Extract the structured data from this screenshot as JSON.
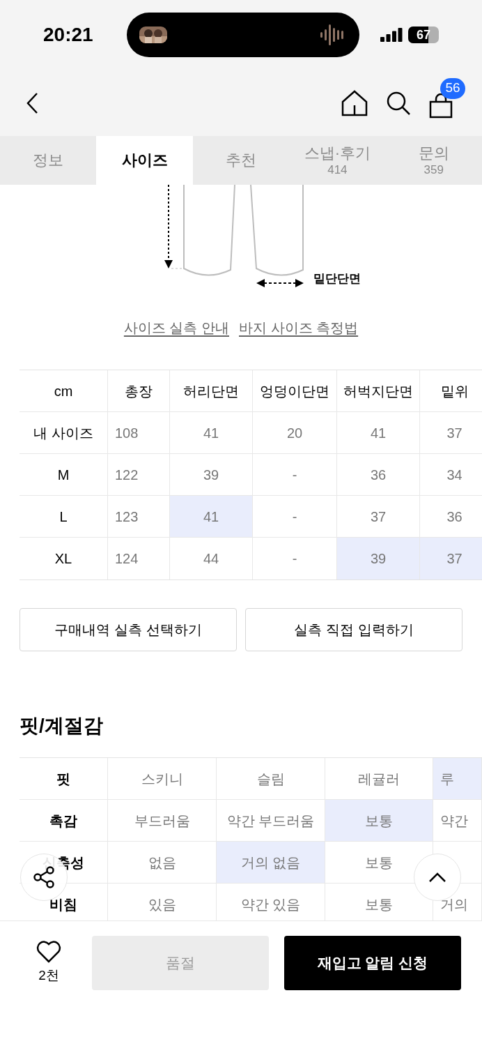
{
  "status_bar": {
    "time": "20:21",
    "battery": "67"
  },
  "nav": {
    "cart_count": "56"
  },
  "tabs": [
    {
      "label": "정보",
      "selected": false
    },
    {
      "label": "사이즈",
      "selected": true
    },
    {
      "label": "추천",
      "selected": false
    },
    {
      "label": "스냅·후기",
      "count": "414",
      "selected": false
    },
    {
      "label": "문의",
      "count": "359",
      "selected": false
    }
  ],
  "diagram": {
    "label": "밑단단면"
  },
  "links": [
    "사이즈 실측 안내",
    "바지 사이즈 측정법"
  ],
  "size_table": {
    "corner": "cm",
    "columns": [
      "총장",
      "허리단면",
      "엉덩이단면",
      "허벅지단면",
      "밑위"
    ],
    "rows": [
      {
        "label": "내 사이즈",
        "cells": [
          {
            "text": "108",
            "highlighted": false
          },
          {
            "text": "41",
            "highlighted": false
          },
          {
            "text": "20",
            "highlighted": false
          },
          {
            "text": "41",
            "highlighted": false
          },
          {
            "text": "37",
            "highlighted": false
          }
        ]
      },
      {
        "label": "M",
        "cells": [
          {
            "text": "122",
            "highlighted": false
          },
          {
            "text": "39",
            "highlighted": false
          },
          {
            "text": "-",
            "highlighted": false
          },
          {
            "text": "36",
            "highlighted": false
          },
          {
            "text": "34",
            "highlighted": false
          }
        ]
      },
      {
        "label": "L",
        "cells": [
          {
            "text": "123",
            "highlighted": false
          },
          {
            "text": "41",
            "highlighted": true
          },
          {
            "text": "-",
            "highlighted": false
          },
          {
            "text": "37",
            "highlighted": false
          },
          {
            "text": "36",
            "highlighted": false
          }
        ]
      },
      {
        "label": "XL",
        "cells": [
          {
            "text": "124",
            "highlighted": false
          },
          {
            "text": "44",
            "highlighted": false
          },
          {
            "text": "-",
            "highlighted": false
          },
          {
            "text": "39",
            "highlighted": true
          },
          {
            "text": "37",
            "highlighted": true
          }
        ]
      }
    ]
  },
  "measure_buttons": [
    "구매내역 실측 선택하기",
    "실측 직접 입력하기"
  ],
  "fit_section": {
    "title": "핏/계절감",
    "rows": [
      {
        "label": "핏",
        "cells": [
          {
            "text": "스키니",
            "highlighted": false
          },
          {
            "text": "슬림",
            "highlighted": false
          },
          {
            "text": "레귤러",
            "highlighted": false
          },
          {
            "text": "루",
            "highlighted": true
          }
        ]
      },
      {
        "label": "촉감",
        "cells": [
          {
            "text": "부드러움",
            "highlighted": false
          },
          {
            "text": "약간 부드러움",
            "highlighted": false
          },
          {
            "text": "보통",
            "highlighted": true
          },
          {
            "text": "약간",
            "highlighted": false
          }
        ]
      },
      {
        "label": "신축성",
        "cells": [
          {
            "text": "없음",
            "highlighted": false
          },
          {
            "text": "거의 없음",
            "highlighted": true
          },
          {
            "text": "보통",
            "highlighted": false
          }
        ]
      },
      {
        "label": "비침",
        "cells": [
          {
            "text": "있음",
            "highlighted": false
          },
          {
            "text": "약간 있음",
            "highlighted": false
          },
          {
            "text": "보통",
            "highlighted": false
          },
          {
            "text": "거의",
            "highlighted": false
          }
        ]
      }
    ]
  },
  "bottom_bar": {
    "likes": "2천",
    "sold_out": {
      "label": "품절",
      "disabled": true
    },
    "restock": "재입고 알림 신청"
  }
}
